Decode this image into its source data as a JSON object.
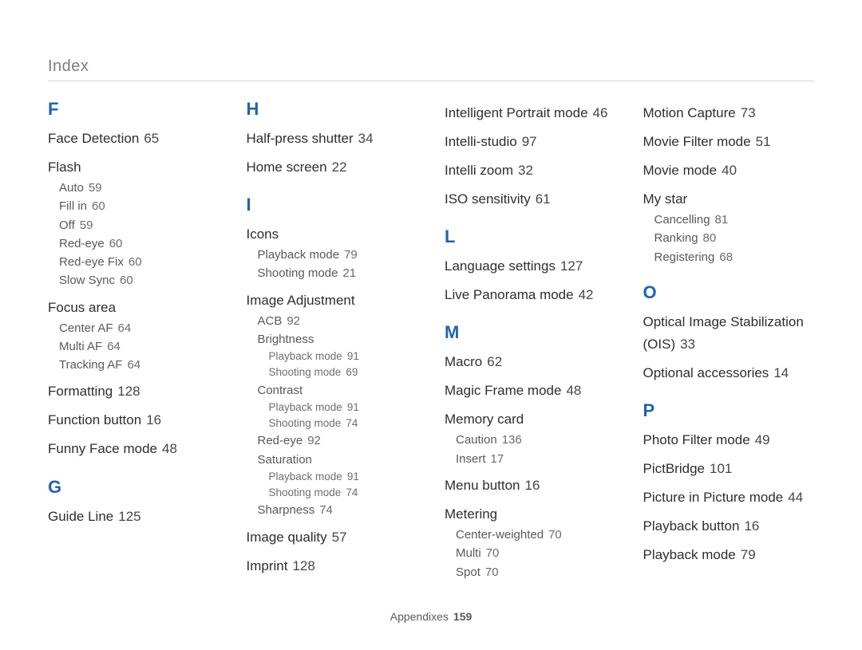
{
  "header": {
    "title": "Index"
  },
  "footer": {
    "label": "Appendixes",
    "page": "159"
  },
  "letters": {
    "F": "F",
    "G": "G",
    "H": "H",
    "I": "I",
    "L": "L",
    "M": "M",
    "O": "O",
    "P": "P"
  },
  "F": {
    "face_detection": {
      "label": "Face Detection",
      "pg": "65"
    },
    "flash": {
      "label": "Flash",
      "auto": {
        "label": "Auto",
        "pg": "59"
      },
      "fill_in": {
        "label": "Fill in",
        "pg": "60"
      },
      "off": {
        "label": "Off",
        "pg": "59"
      },
      "red_eye": {
        "label": "Red-eye",
        "pg": "60"
      },
      "red_eye_fix": {
        "label": "Red-eye Fix",
        "pg": "60"
      },
      "slow_sync": {
        "label": "Slow Sync",
        "pg": "60"
      }
    },
    "focus_area": {
      "label": "Focus area",
      "center_af": {
        "label": "Center AF",
        "pg": "64"
      },
      "multi_af": {
        "label": "Multi AF",
        "pg": "64"
      },
      "tracking_af": {
        "label": "Tracking AF",
        "pg": "64"
      }
    },
    "formatting": {
      "label": "Formatting",
      "pg": "128"
    },
    "function_button": {
      "label": "Function button",
      "pg": "16"
    },
    "funny_face": {
      "label": "Funny Face mode",
      "pg": "48"
    }
  },
  "G": {
    "guide_line": {
      "label": "Guide Line",
      "pg": "125"
    }
  },
  "H": {
    "half_press": {
      "label": "Half-press shutter",
      "pg": "34"
    },
    "home_screen": {
      "label": "Home screen",
      "pg": "22"
    }
  },
  "I": {
    "icons": {
      "label": "Icons",
      "playback": {
        "label": "Playback mode",
        "pg": "79"
      },
      "shooting": {
        "label": "Shooting mode",
        "pg": "21"
      }
    },
    "image_adjustment": {
      "label": "Image Adjustment",
      "acb": {
        "label": "ACB",
        "pg": "92"
      },
      "brightness": {
        "label": "Brightness",
        "playback": {
          "label": "Playback mode",
          "pg": "91"
        },
        "shooting": {
          "label": "Shooting mode",
          "pg": "69"
        }
      },
      "contrast": {
        "label": "Contrast",
        "playback": {
          "label": "Playback mode",
          "pg": "91"
        },
        "shooting": {
          "label": "Shooting mode",
          "pg": "74"
        }
      },
      "red_eye": {
        "label": "Red-eye",
        "pg": "92"
      },
      "saturation": {
        "label": "Saturation",
        "playback": {
          "label": "Playback mode",
          "pg": "91"
        },
        "shooting": {
          "label": "Shooting mode",
          "pg": "74"
        }
      },
      "sharpness": {
        "label": "Sharpness",
        "pg": "74"
      }
    },
    "image_quality": {
      "label": "Image quality",
      "pg": "57"
    },
    "imprint": {
      "label": "Imprint",
      "pg": "128"
    },
    "intelligent_portrait": {
      "label": "Intelligent Portrait mode",
      "pg": "46"
    },
    "intelli_studio": {
      "label": "Intelli-studio",
      "pg": "97"
    },
    "intelli_zoom": {
      "label": "Intelli zoom",
      "pg": "32"
    },
    "iso": {
      "label": "ISO sensitivity",
      "pg": "61"
    }
  },
  "L": {
    "language": {
      "label": "Language settings",
      "pg": "127"
    },
    "live_panorama": {
      "label": "Live Panorama mode",
      "pg": "42"
    }
  },
  "M": {
    "macro": {
      "label": "Macro",
      "pg": "62"
    },
    "magic_frame": {
      "label": "Magic Frame mode",
      "pg": "48"
    },
    "memory_card": {
      "label": "Memory card",
      "caution": {
        "label": "Caution",
        "pg": "136"
      },
      "insert": {
        "label": "Insert",
        "pg": "17"
      }
    },
    "menu_button": {
      "label": "Menu button",
      "pg": "16"
    },
    "metering": {
      "label": "Metering",
      "center": {
        "label": "Center-weighted",
        "pg": "70"
      },
      "multi": {
        "label": "Multi",
        "pg": "70"
      },
      "spot": {
        "label": "Spot",
        "pg": "70"
      }
    },
    "motion_capture": {
      "label": "Motion Capture",
      "pg": "73"
    },
    "movie_filter": {
      "label": "Movie Filter mode",
      "pg": "51"
    },
    "movie_mode": {
      "label": "Movie mode",
      "pg": "40"
    },
    "my_star": {
      "label": "My star",
      "cancelling": {
        "label": "Cancelling",
        "pg": "81"
      },
      "ranking": {
        "label": "Ranking",
        "pg": "80"
      },
      "registering": {
        "label": "Registering",
        "pg": "68"
      }
    }
  },
  "O": {
    "ois": {
      "label": "Optical Image Stabilization (OIS)",
      "pg": "33"
    },
    "optional": {
      "label": "Optional accessories",
      "pg": "14"
    }
  },
  "P": {
    "photo_filter": {
      "label": "Photo Filter mode",
      "pg": "49"
    },
    "pictbridge": {
      "label": "PictBridge",
      "pg": "101"
    },
    "pip": {
      "label": "Picture in Picture mode",
      "pg": "44"
    },
    "playback_button": {
      "label": "Playback button",
      "pg": "16"
    },
    "playback_mode": {
      "label": "Playback mode",
      "pg": "79"
    }
  }
}
